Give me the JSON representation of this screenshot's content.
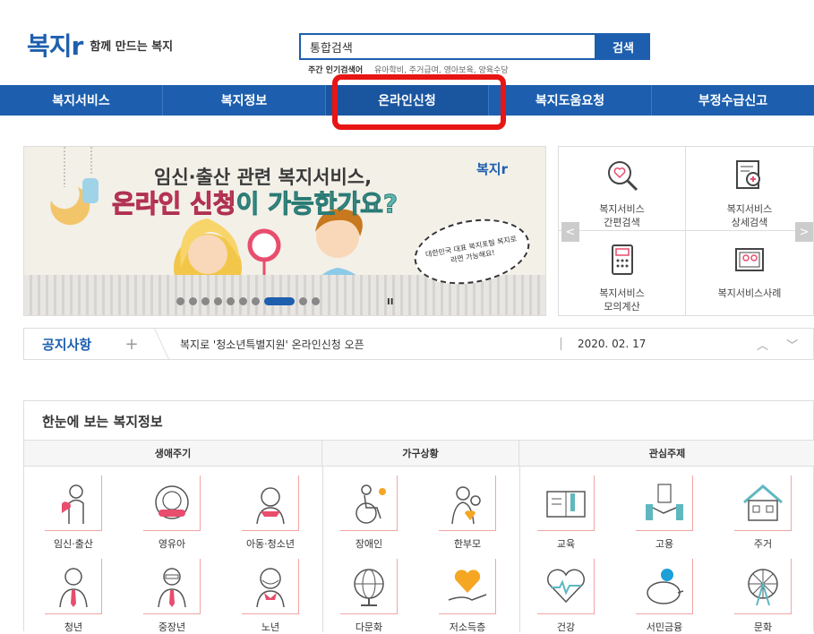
{
  "header": {
    "logo_text": "복지r",
    "slogan": "함께 만드는 복지",
    "search_value": "통합검색",
    "search_button": "검색",
    "popular_label": "주간 인기검색어",
    "popular_words": "유아학비, 주거급여, 영아보육, 양육수당"
  },
  "gnb": {
    "items": [
      {
        "label": "복지서비스"
      },
      {
        "label": "복지정보"
      },
      {
        "label": "온라인신청"
      },
      {
        "label": "복지도움요청"
      },
      {
        "label": "부정수급신고"
      }
    ],
    "highlight_color": "#e81515"
  },
  "banner": {
    "title_line1": "임신·출산 관련 복지서비스,",
    "title_line2_em": "온라인 신청",
    "title_line2_rest": "이 가능한가요?",
    "logo": "복지r",
    "bubble": "대한민국 대표 복지포털 복지로라면 가능해요!",
    "pause": "II"
  },
  "quick": {
    "items": [
      {
        "label1": "복지서비스",
        "label2": "간편검색"
      },
      {
        "label1": "복지서비스",
        "label2": "상세검색"
      },
      {
        "label1": "복지서비스",
        "label2": "모의계산"
      },
      {
        "label1": "복지서비스사례",
        "label2": ""
      }
    ],
    "prev": "<",
    "next": ">"
  },
  "notice": {
    "title": "공지사항",
    "plus": "+",
    "text": "복지로 '청소년특별지원' 온라인신청 오픈",
    "date": "2020. 02. 17",
    "arrows": "︿ ﹀"
  },
  "info": {
    "title": "한눈에 보는 복지정보",
    "groups": [
      {
        "label": "생애주기"
      },
      {
        "label": "가구상황"
      },
      {
        "label": "관심주제"
      }
    ],
    "row1": [
      {
        "label": "임신·출산"
      },
      {
        "label": "영유아"
      },
      {
        "label": "아동·청소년"
      },
      {
        "label": "장애인"
      },
      {
        "label": "한부모"
      },
      {
        "label": "교육"
      },
      {
        "label": "고용"
      },
      {
        "label": "주거"
      }
    ],
    "row2": [
      {
        "label": "청년"
      },
      {
        "label": "중장년"
      },
      {
        "label": "노년"
      },
      {
        "label": "다문화"
      },
      {
        "label": "저소득층"
      },
      {
        "label": "건강"
      },
      {
        "label": "서민금융"
      },
      {
        "label": "문화"
      }
    ]
  },
  "colors": {
    "brand": "#1d5fae",
    "accent_pink": "#e84d6e"
  }
}
